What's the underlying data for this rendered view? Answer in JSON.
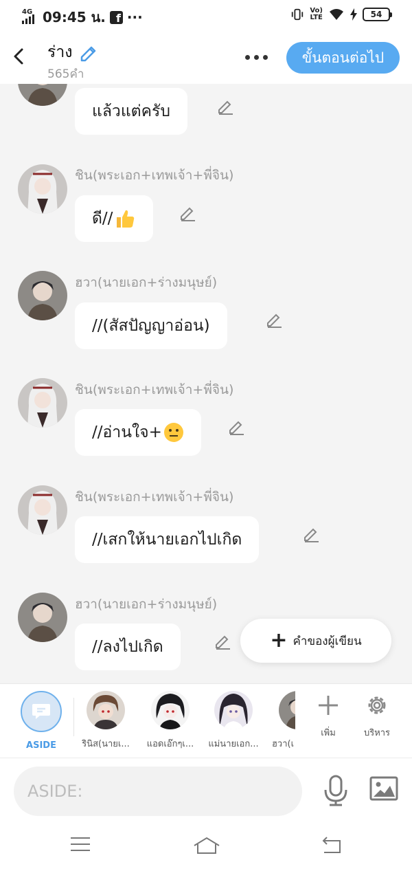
{
  "status_bar": {
    "network_type": "4G",
    "time": "09:45 น.",
    "facebook_glyph": "f",
    "more_glyph": "···",
    "volte": [
      "Vo)",
      "LTE"
    ],
    "battery": "54"
  },
  "header": {
    "title": "ร่าง",
    "word_count": "565คำ",
    "next_button": "ขั้นตอนต่อไป"
  },
  "messages": [
    {
      "speaker": "",
      "text": "แล้วแต่ครับ",
      "emoji": "",
      "avatar": "hwa"
    },
    {
      "speaker": "ชิน(พระเอก+เทพเจ้า+พี่จิน)",
      "text": "ดี//",
      "emoji": "thumbs-up",
      "avatar": "shin"
    },
    {
      "speaker": "ฮวา(นายเอก+ร่างมนุษย์)",
      "text": "//(สัสปัญญาอ่อน)",
      "emoji": "",
      "avatar": "hwa"
    },
    {
      "speaker": "ชิน(พระเอก+เทพเจ้า+พี่จิน)",
      "text": "//อ่านใจ+",
      "emoji": "neutral-face",
      "avatar": "shin"
    },
    {
      "speaker": "ชิน(พระเอก+เทพเจ้า+พี่จิน)",
      "text": "//เสกให้นายเอกไปเกิด",
      "emoji": "",
      "avatar": "shin"
    },
    {
      "speaker": "ฮวา(นายเอก+ร่างมนุษย์)",
      "text": "//ลงไปเกิด",
      "emoji": "",
      "avatar": "hwa"
    }
  ],
  "fab": {
    "label": "คำของผู้เขียน"
  },
  "characters": {
    "aside_label": "ASIDE",
    "items": [
      {
        "name": "รินิส(นายเ..."
      },
      {
        "name": "แอดเอ๊กๆเ..."
      },
      {
        "name": "แม่นายเอก..."
      },
      {
        "name": "ฮวา(เ"
      }
    ],
    "add_label": "เพิ่ม",
    "manage_label": "บริหาร"
  },
  "input": {
    "placeholder": "ASIDE:"
  },
  "colors": {
    "accent": "#58aaf1",
    "aside_blue": "#4a9be6",
    "background": "#f4f4f4",
    "bubble": "#ffffff"
  },
  "icons": [
    "back-arrow-icon",
    "pencil-icon",
    "more-dots-icon",
    "microphone-icon",
    "image-icon",
    "plus-icon",
    "gear-icon",
    "menu-icon",
    "home-icon",
    "return-icon"
  ]
}
